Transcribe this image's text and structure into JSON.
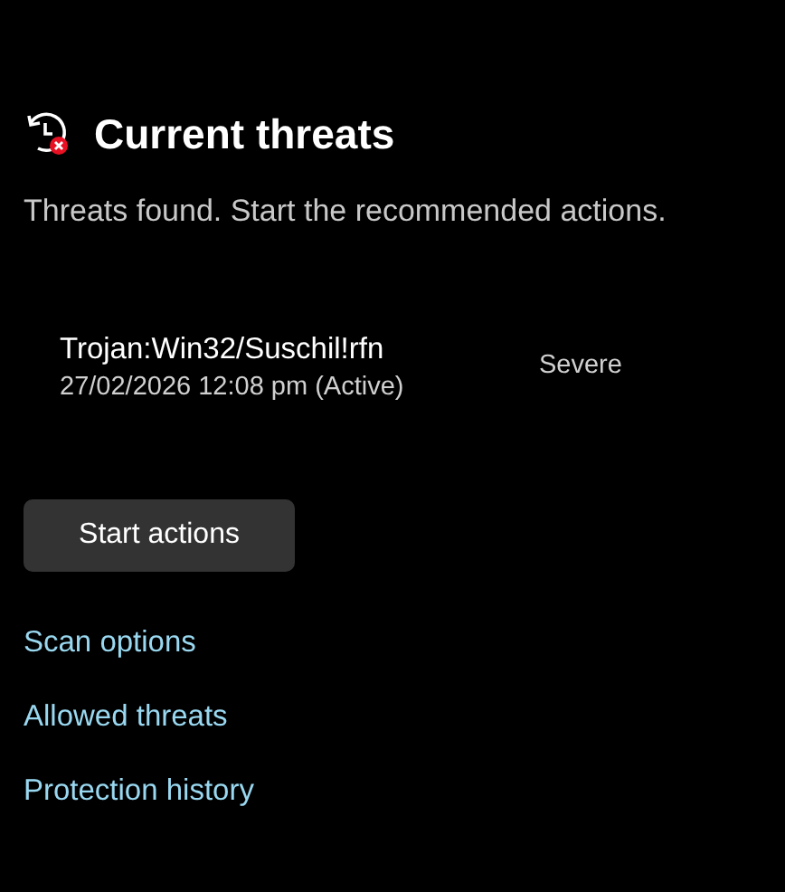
{
  "header": {
    "title": "Current threats",
    "subtitle": "Threats found. Start the recommended actions."
  },
  "threats": [
    {
      "name": "Trojan:Win32/Suschil!rfn",
      "detail": "27/02/2026 12:08 pm (Active)",
      "severity": "Severe"
    }
  ],
  "primary_button": "Start actions",
  "links": [
    "Scan options",
    "Allowed threats",
    "Protection history"
  ]
}
